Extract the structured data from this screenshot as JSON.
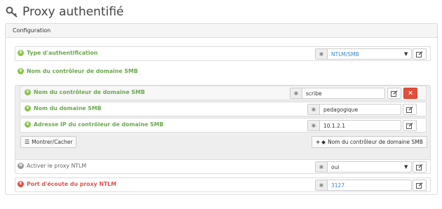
{
  "page": {
    "title": "Proxy authentifié",
    "title_icon": "key-icon"
  },
  "panel": {
    "header": "Configuration"
  },
  "fields": {
    "auth_type": {
      "badge": "S",
      "label": "Type d'authentification",
      "required_mark": "✱",
      "value": "NTLM/SMB"
    },
    "dc_name_group": {
      "badge": "S",
      "label": "Nom du contrôleur de domaine SMB"
    },
    "dc_name": {
      "badge": "S",
      "label": "Nom du contrôleur de domaine SMB",
      "required_mark": "✱",
      "value": "scribe",
      "remove_label": "×"
    },
    "domain_name": {
      "badge": "S",
      "label": "Nom du domaine SMB",
      "required_mark": "✱",
      "value": "pedagogique"
    },
    "dc_ip": {
      "badge": "S",
      "label": "Adresse IP du contrôleur de domaine SMB",
      "required_mark": "✱",
      "value": "10.1.2.1"
    },
    "ntlm_proxy": {
      "badge": "N",
      "label": "Activer le proxy NTLM",
      "required_mark": "✱",
      "value": "oui"
    },
    "proxy_port": {
      "badge": "E",
      "label": "Port d'écoute du proxy NTLM",
      "required_mark": "✱",
      "value": "3127"
    }
  },
  "buttons": {
    "show_hide": "Montrer/Cacher",
    "add_dc": "Nom du contrôleur de domaine SMB",
    "add_dc_prefix": "+"
  },
  "colors": {
    "green": "#6aa84f",
    "red": "#d9534f",
    "blue": "#3a87c7",
    "danger": "#e0503c"
  }
}
